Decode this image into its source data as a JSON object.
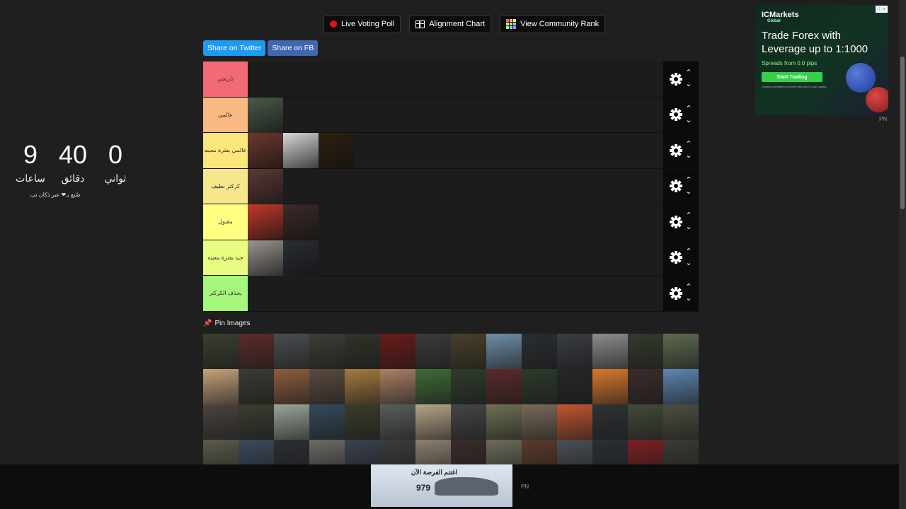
{
  "topbar": {
    "live_voting": "Live Voting Poll",
    "alignment_chart": "Alignment Chart",
    "community_rank": "View Community Rank"
  },
  "share": {
    "twitter": "Share on Twitter",
    "facebook": "Share on FB"
  },
  "tiers": [
    {
      "label": "تاريخي",
      "color": "#f26a76",
      "items": []
    },
    {
      "label": "عالمي",
      "color": "#f8b982",
      "items": [
        "#4a5a4a"
      ]
    },
    {
      "label": "عالمي بفترة معينه",
      "color": "#fbe67c",
      "items": [
        "#6b3a2c",
        "#d8d8d8",
        "#2c2010"
      ]
    },
    {
      "label": "كركتر نظيف",
      "color": "#f7e78b",
      "items": [
        "#5b3a35"
      ]
    },
    {
      "label": "مقبول",
      "color": "#ffff81",
      "items": [
        "#c0392b",
        "#3b2a28"
      ]
    },
    {
      "label": "جيد بفترة معينة",
      "color": "#e9fb80",
      "items": [
        "#9a958e",
        "#2a2d33"
      ]
    },
    {
      "label": "يحذف الكركتر",
      "color": "#a6f77d",
      "items": []
    }
  ],
  "timer": {
    "hours": "9",
    "hours_label": "ساعات",
    "minutes": "40",
    "minutes_label": "دقائق",
    "seconds": "0",
    "seconds_label": "ثواني",
    "credit": "صُنع بـ❤ عبر ذكان تب"
  },
  "pin": {
    "label": "Pin Images"
  },
  "pool_colors": [
    "#3a3f2f",
    "#5c2a2a",
    "#4a4e50",
    "#3c3d35",
    "#2f3328",
    "#6b1a1a",
    "#3a3b3c",
    "#4a3f2a",
    "#6f8ea8",
    "#2a2d30",
    "#3a3c44",
    "#8a8c8e",
    "#333a2e",
    "#5d6a4e",
    "#c5a27a",
    "#3a3b34",
    "#8d5d3e",
    "#5a4b3f",
    "#a47a3d",
    "#a88065",
    "#3e6b35",
    "#2f3c2c",
    "#5a2a2a",
    "#2c3a2b",
    "#242628",
    "#d9782d",
    "#3a2c2a",
    "#5e86b3",
    "#4a4340",
    "#3a3d31",
    "#9aa49a",
    "#354a5a",
    "#3a3c2a",
    "#595e5a",
    "#b8a58a",
    "#454545",
    "#6e7052",
    "#7a6a5a",
    "#c0572f",
    "#2d3235",
    "#434a3a",
    "#4b4f3f",
    "#5a5a4a",
    "#3c4a5e",
    "#2c2e33",
    "#6d6a66",
    "#3a4250",
    "#3a3c3e",
    "#8d7f6f",
    "#3a2b2a",
    "#6b6a5a",
    "#5a3a2a",
    "#4a5058",
    "#2a2f35",
    "#7d1f20",
    "#3a3b34"
  ],
  "ad_top": {
    "brand": "ICMarkets",
    "brand_sub": "Global",
    "headline_1": "Trade Forex with",
    "headline_2": "Leverage up to 1:1000",
    "sub": "Spreads from 0.0 pips",
    "cta": "Start Trading",
    "fine": "Trading derivatives involves high risk to your capital.",
    "pn": "PN"
  },
  "ad_bottom": {
    "title": "اغتنم الفرصة الآن",
    "price": "979",
    "pn": "PN"
  }
}
